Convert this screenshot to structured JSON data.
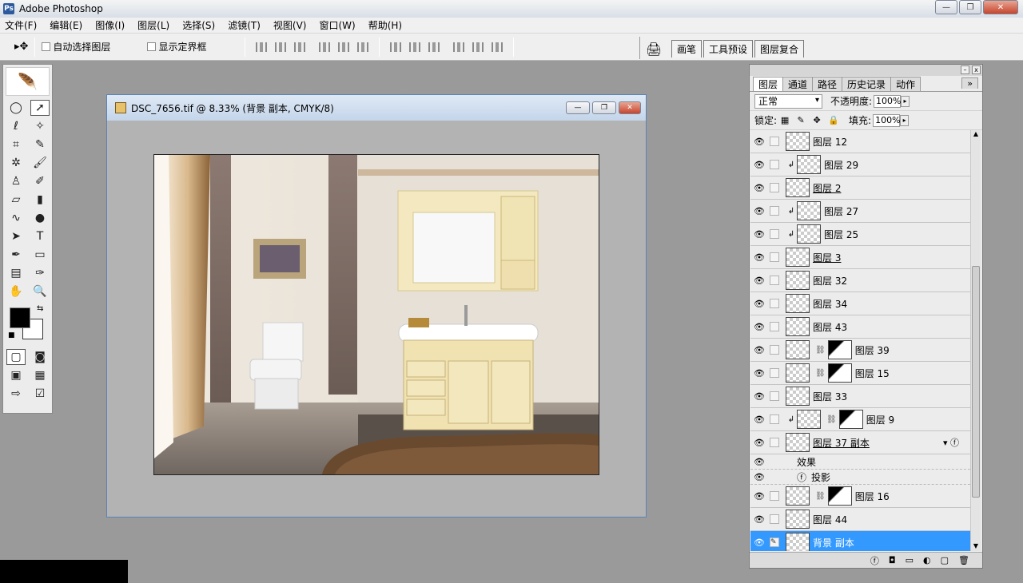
{
  "app": {
    "title": "Adobe Photoshop",
    "logo_text": "Ps"
  },
  "window_buttons": {
    "minimize": "—",
    "restore": "❐",
    "close": "✕"
  },
  "menu": [
    "文件(F)",
    "编辑(E)",
    "图像(I)",
    "图层(L)",
    "选择(S)",
    "滤镜(T)",
    "视图(V)",
    "窗口(W)",
    "帮助(H)"
  ],
  "options": {
    "move_tool": "▸✥",
    "auto_select": "自动选择图层",
    "show_bounds": "显示定界框"
  },
  "palette_well": [
    "画笔",
    "工具预设",
    "图层复合"
  ],
  "document": {
    "title": "DSC_7656.tif @ 8.33% (背景 副本, CMYK/8)"
  },
  "layers_panel": {
    "tabs": [
      "图层",
      "通道",
      "路径",
      "历史记录",
      "动作"
    ],
    "more": "»",
    "blend_mode": "正常",
    "opacity_label": "不透明度:",
    "opacity": "100%",
    "lock_label": "锁定:",
    "fill_label": "填充:",
    "fill": "100%",
    "layers": [
      {
        "name": "图层 12",
        "clip": false,
        "mask": false,
        "ul": false
      },
      {
        "name": "图层 29",
        "clip": true,
        "mask": false,
        "ul": false
      },
      {
        "name": "图层 2",
        "clip": false,
        "mask": false,
        "ul": true
      },
      {
        "name": "图层 27",
        "clip": true,
        "mask": false,
        "ul": false
      },
      {
        "name": "图层 25",
        "clip": true,
        "mask": false,
        "ul": false
      },
      {
        "name": "图层 3",
        "clip": false,
        "mask": false,
        "ul": true
      },
      {
        "name": "图层 32",
        "clip": false,
        "mask": false,
        "ul": false
      },
      {
        "name": "图层 34",
        "clip": false,
        "mask": false,
        "ul": false
      },
      {
        "name": "图层 43",
        "clip": false,
        "mask": false,
        "ul": false
      },
      {
        "name": "图层 39",
        "clip": false,
        "mask": true,
        "ul": false
      },
      {
        "name": "图层 15",
        "clip": false,
        "mask": true,
        "ul": false
      },
      {
        "name": "图层 33",
        "clip": false,
        "mask": false,
        "ul": false
      },
      {
        "name": "图层 9",
        "clip": true,
        "mask": true,
        "ul": false
      },
      {
        "name": "图层 37 副本",
        "clip": false,
        "mask": false,
        "ul": true,
        "fx": true
      }
    ],
    "effects_label": "效果",
    "effect_item": "投影",
    "layers_after": [
      {
        "name": "图层 16",
        "mask": true
      },
      {
        "name": "图层 44",
        "mask": false
      }
    ],
    "selected_layer": "背景 副本",
    "bottom_icons": [
      "ⓕ",
      "◘",
      "▭",
      "◐",
      "▢",
      "🗑"
    ]
  }
}
